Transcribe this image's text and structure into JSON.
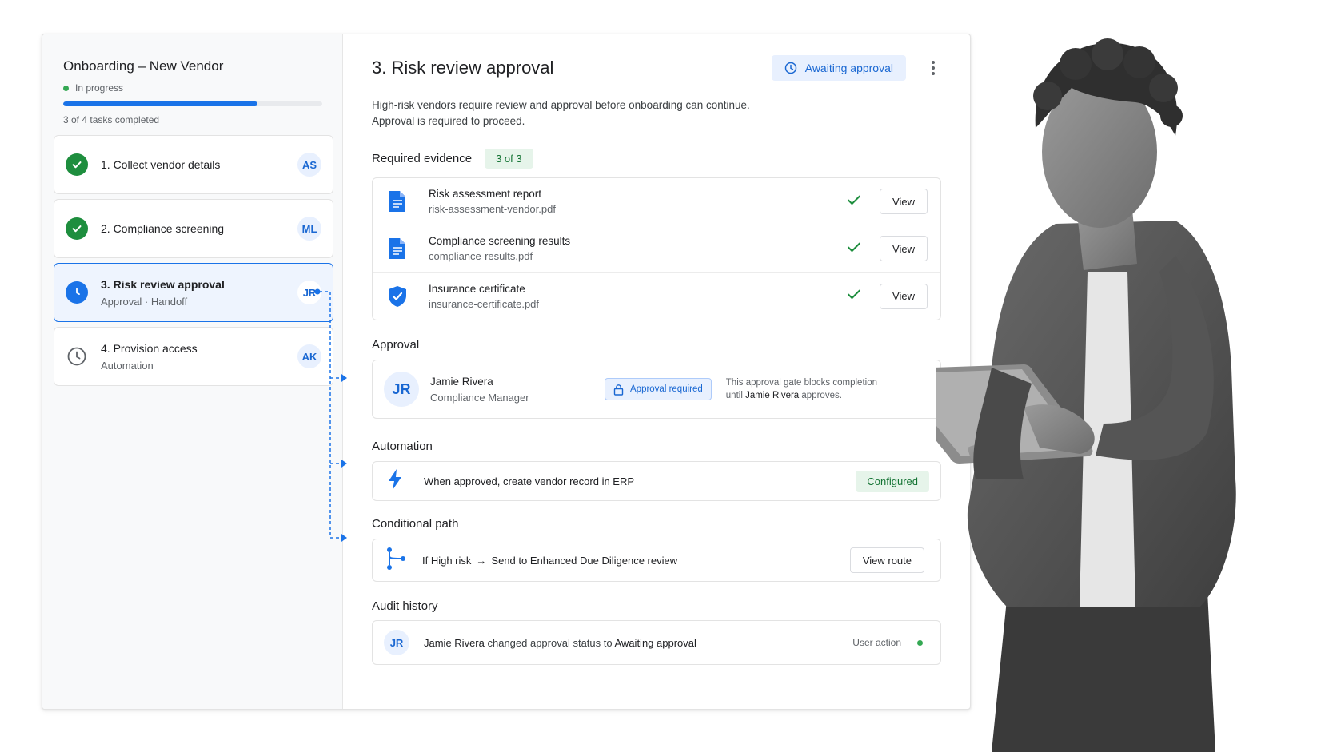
{
  "workflow": {
    "title": "Onboarding – New Vendor",
    "status": "In progress",
    "progress_fraction": 0.75,
    "tasks_completed": "3 of 4 tasks completed"
  },
  "tasks": [
    {
      "label": "1. Collect vendor details",
      "sub": "",
      "assignee": "AS",
      "state": "done"
    },
    {
      "label": "2. Compliance screening",
      "sub": "",
      "assignee": "ML",
      "state": "done"
    },
    {
      "label": "3. Risk review approval",
      "sub": "Approval · Handoff",
      "assignee": "JR",
      "state": "current"
    },
    {
      "label": "4. Provision access",
      "sub": "Automation",
      "assignee": "AK",
      "state": "pending"
    }
  ],
  "detail": {
    "title": "3. Risk review approval",
    "status_pill": "Awaiting approval",
    "description_line1": "High-risk vendors require review and approval before onboarding can continue.",
    "description_line2": "Approval is required to proceed."
  },
  "evidence": {
    "title": "Required evidence",
    "count": "3 of 3",
    "items": [
      {
        "name": "Risk assessment report",
        "file": "risk-assessment-vendor.pdf",
        "icon": "document-icon",
        "action": "View"
      },
      {
        "name": "Compliance screening results",
        "file": "compliance-results.pdf",
        "icon": "document-icon",
        "action": "View"
      },
      {
        "name": "Insurance certificate",
        "file": "insurance-certificate.pdf",
        "icon": "shield-check-icon",
        "action": "View"
      }
    ]
  },
  "approval": {
    "title": "Approval",
    "initials": "JR",
    "name": "Jamie Rivera",
    "role": "Compliance Manager",
    "badge": "Approval required",
    "note_prefix": "This approval gate blocks completion",
    "note_mid": "until",
    "note_name": "Jamie Rivera",
    "note_suffix": "approves."
  },
  "automation": {
    "title": "Automation",
    "text": "When approved, create vendor record in ERP",
    "status": "Configured"
  },
  "conditional": {
    "title": "Conditional path",
    "condition": "If High risk",
    "arrow": "→",
    "target": "Send to Enhanced Due Diligence review",
    "action": "View route"
  },
  "audit": {
    "title": "Audit history",
    "initials": "JR",
    "actor": "Jamie Rivera",
    "verb": "changed approval status to",
    "value": "Awaiting approval",
    "meta": "User action"
  },
  "colors": {
    "accent": "#1a73e8",
    "success": "#1e8e3e",
    "success_bg": "#e6f4ea",
    "accent_bg": "#e8f0fe"
  }
}
